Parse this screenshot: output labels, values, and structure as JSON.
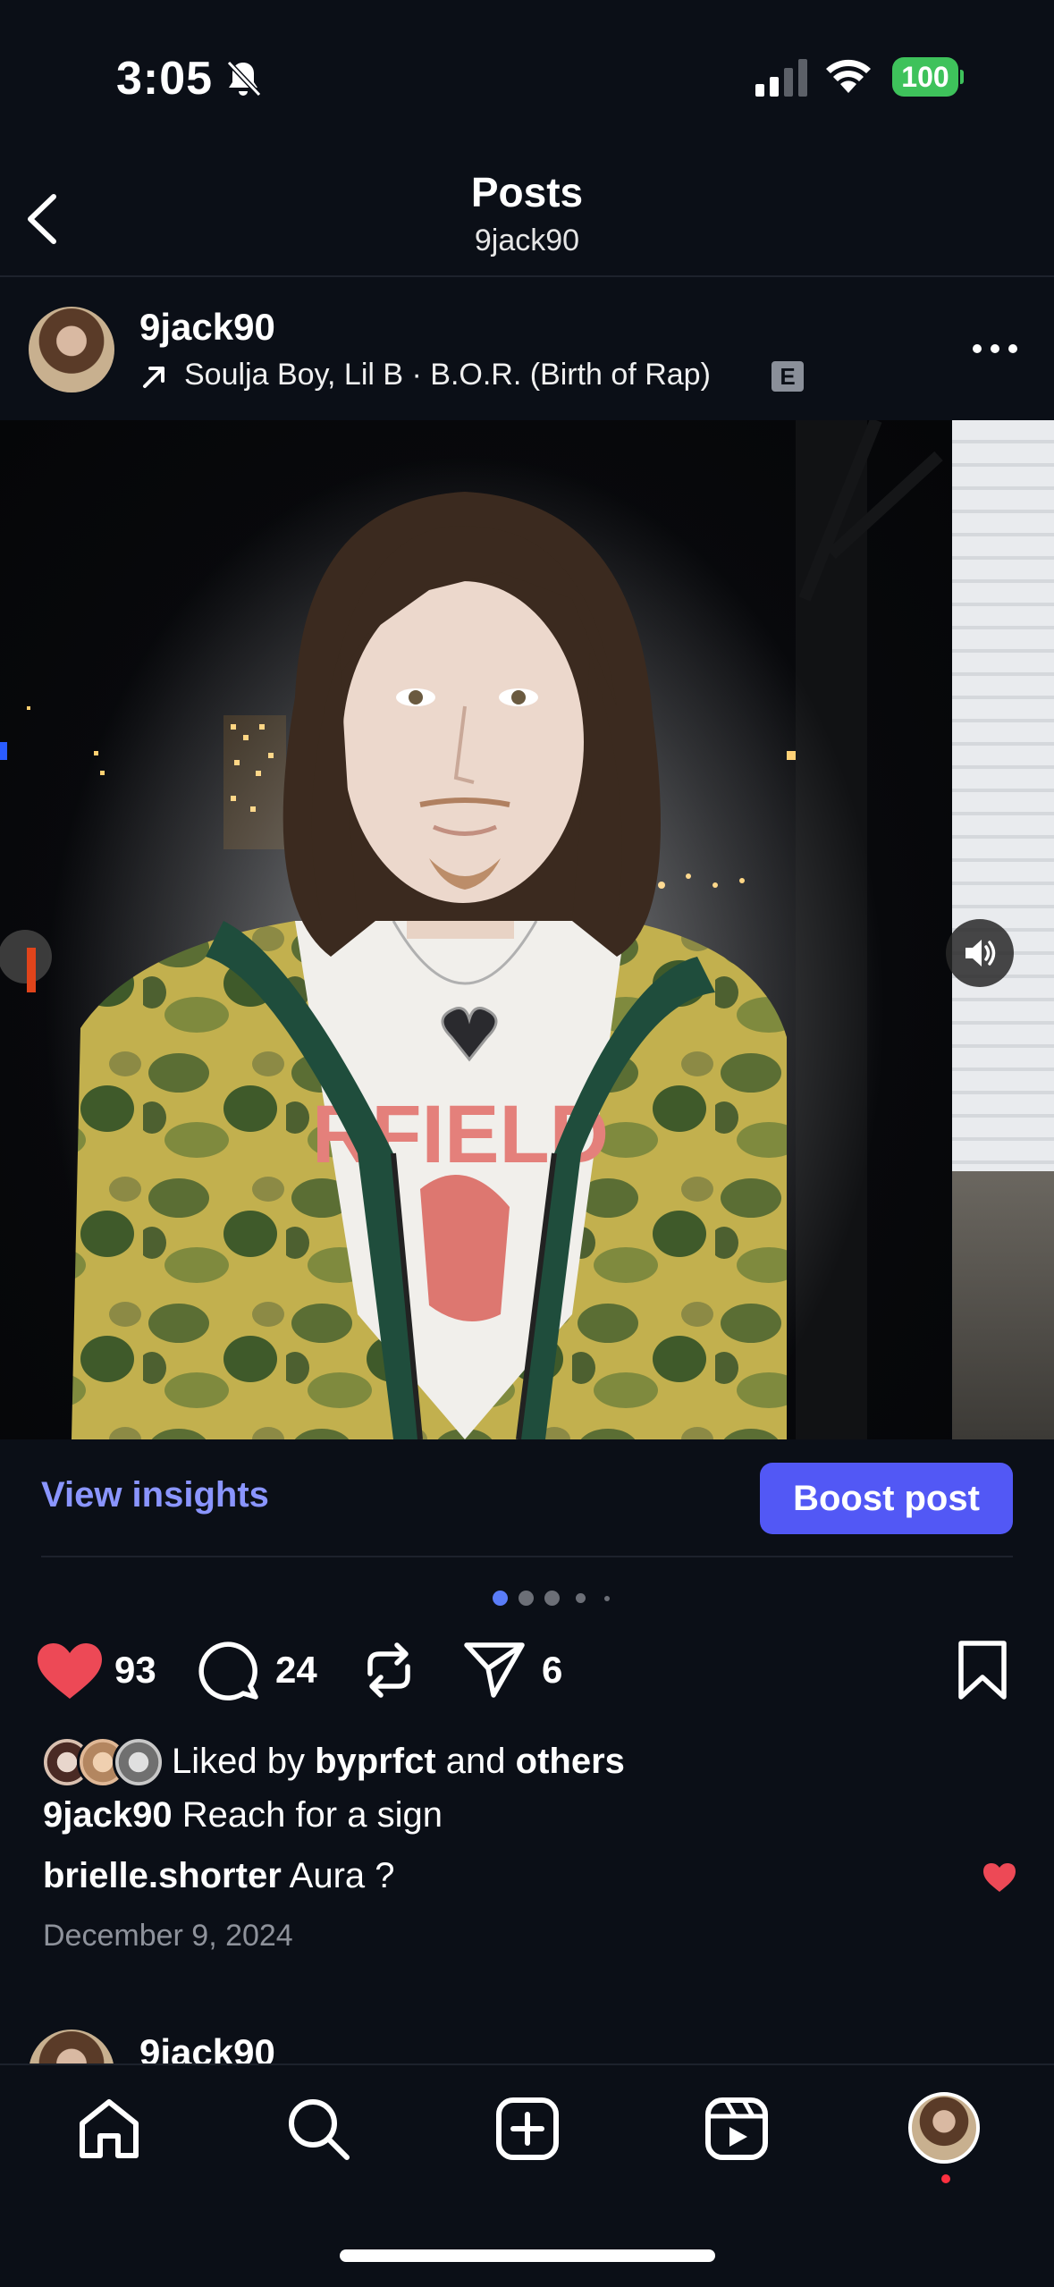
{
  "status_bar": {
    "time": "3:05",
    "battery": "100"
  },
  "header": {
    "title": "Posts",
    "subtitle": "9jack90"
  },
  "post": {
    "username": "9jack90",
    "music": "Soulja Boy, Lil B · B.O.R. (Birth of Rap)",
    "explicit": "E",
    "view_insights": "View insights",
    "boost": "Boost post",
    "likes": "93",
    "comments": "24",
    "shares": "6",
    "liked_by_prefix": "Liked by ",
    "liked_by_user": "byprfct",
    "liked_by_and": " and ",
    "liked_by_others": "others",
    "caption_user": "9jack90",
    "caption_text": " Reach for a sign",
    "comment_user": "brielle.shorter",
    "comment_text": " Aura ?",
    "date": "December 9, 2024",
    "shirt_text": "RFIELD"
  },
  "next_post": {
    "username": "9jack90"
  },
  "colors": {
    "accent": "#5258f5",
    "insights": "#8a95ff",
    "like": "#ed4956",
    "background": "#0b0f17"
  }
}
